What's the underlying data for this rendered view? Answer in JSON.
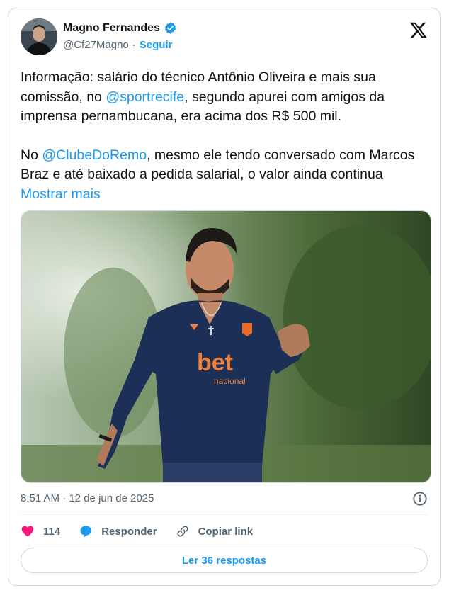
{
  "author": {
    "name": "Magno Fernandes",
    "handle": "@Cf27Magno",
    "separator": "·",
    "follow_label": "Seguir"
  },
  "post": {
    "p1_before": "Informação: salário do técnico Antônio Oliveira e mais sua comissão, no ",
    "p1_mention": "@sportrecife",
    "p1_after": ", segundo apurei com amigos da imprensa pernambucana, era acima dos R$ 500 mil.",
    "p2_before": "No ",
    "p2_mention": "@ClubeDoRemo",
    "p2_after": ", mesmo ele tendo conversado com Marcos Braz e até baixado a pedida salarial, o valor ainda continua ",
    "show_more": "Mostrar mais",
    "timestamp": "8:51 AM · 12 de jun de 2025"
  },
  "photo": {
    "shirt_logo_word": "bet",
    "shirt_logo_sub": "nacional"
  },
  "actions": {
    "like_count": "114",
    "reply_label": "Responder",
    "copy_label": "Copiar link"
  },
  "footer": {
    "read_replies": "Ler 36 respostas"
  },
  "colors": {
    "accent": "#1d9bf0",
    "like": "#f91880",
    "text": "#0f1419",
    "muted": "#536471"
  }
}
